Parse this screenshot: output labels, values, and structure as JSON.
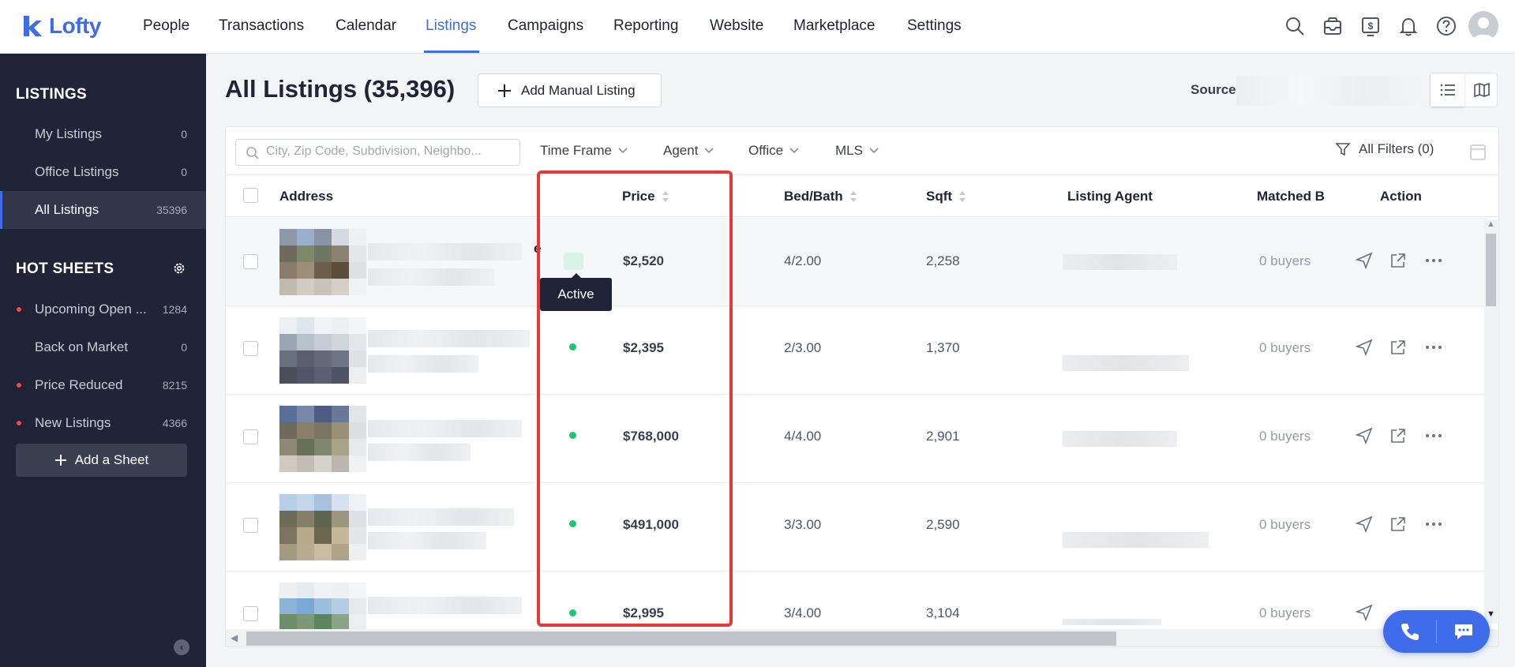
{
  "brand": {
    "name": "Lofty",
    "accent": "#3f6ce8"
  },
  "nav": {
    "items": [
      "People",
      "Transactions",
      "Calendar",
      "Listings",
      "Campaigns",
      "Reporting",
      "Website",
      "Marketplace",
      "Settings"
    ],
    "active": "Listings"
  },
  "sidebar": {
    "listings_heading": "LISTINGS",
    "listings": [
      {
        "label": "My Listings",
        "count": "0"
      },
      {
        "label": "Office Listings",
        "count": "0"
      },
      {
        "label": "All Listings",
        "count": "35396"
      }
    ],
    "hot_sheets_heading": "HOT SHEETS",
    "hot_sheets": [
      {
        "label": "Upcoming Open ...",
        "count": "1284",
        "dot": true
      },
      {
        "label": "Back on Market",
        "count": "0",
        "dot": false
      },
      {
        "label": "Price Reduced",
        "count": "8215",
        "dot": true
      },
      {
        "label": "New Listings",
        "count": "4366",
        "dot": true
      }
    ],
    "add_sheet_label": "Add a Sheet"
  },
  "header": {
    "title": "All Listings (35,396)",
    "add_manual_label": "Add Manual Listing",
    "source_label": "Source"
  },
  "filters": {
    "search_placeholder": "City, Zip Code, Subdivision, Neighbo...",
    "time_frame": "Time Frame",
    "agent": "Agent",
    "office": "Office",
    "mls": "MLS",
    "all_filters": "All Filters (0)"
  },
  "table": {
    "columns": {
      "address": "Address",
      "price": "Price",
      "bed_bath": "Bed/Bath",
      "sqft": "Sqft",
      "listing_agent": "Listing Agent",
      "matched": "Matched B",
      "action": "Action"
    },
    "rows": [
      {
        "price": "$2,520",
        "bed_bath": "4/2.00",
        "sqft": "2,258",
        "buyers": "0 buyers"
      },
      {
        "price": "$2,395",
        "bed_bath": "2/3.00",
        "sqft": "1,370",
        "buyers": "0 buyers"
      },
      {
        "price": "$768,000",
        "bed_bath": "4/4.00",
        "sqft": "2,901",
        "buyers": "0 buyers"
      },
      {
        "price": "$491,000",
        "bed_bath": "3/3.00",
        "sqft": "2,590",
        "buyers": "0 buyers"
      },
      {
        "price": "$2,995",
        "bed_bath": "3/4.00",
        "sqft": "3,104",
        "buyers": "0 buyers"
      }
    ],
    "row0_partial_text": "e",
    "status_tooltip": "Active",
    "status_color": "#20c472"
  },
  "highlight_color": "#e53935"
}
